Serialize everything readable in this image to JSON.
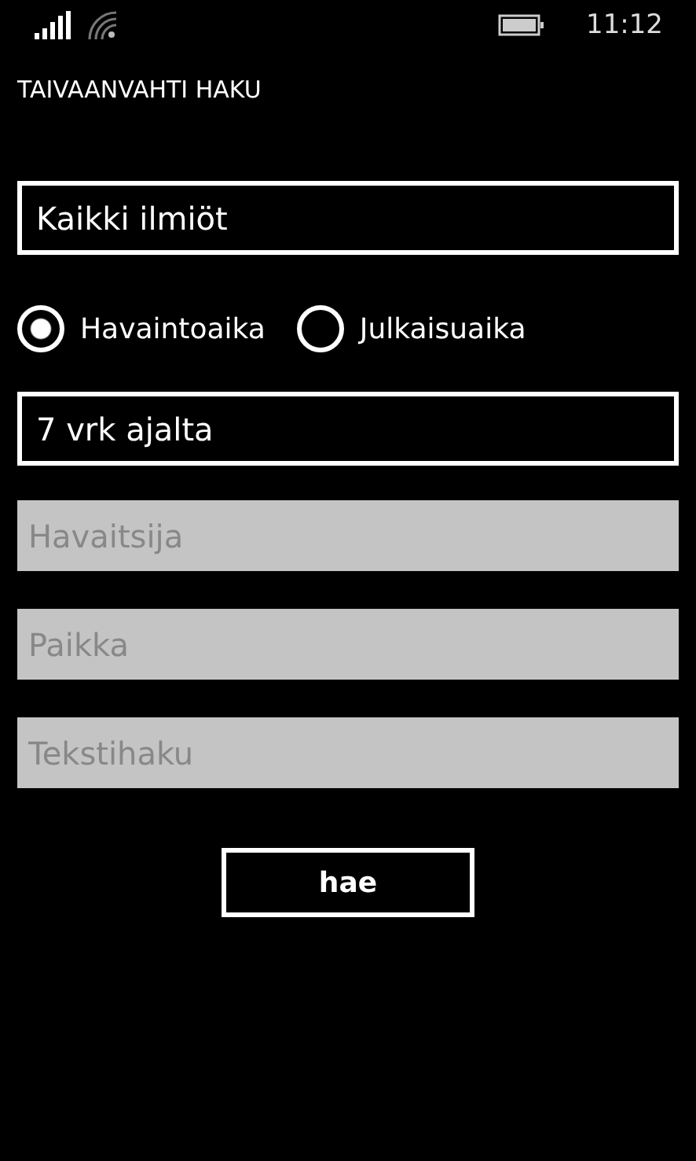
{
  "status_bar": {
    "time": "11:12"
  },
  "app_title": "TAIVAANVAHTI HAKU",
  "category_picker": {
    "value": "Kaikki ilmiöt"
  },
  "time_mode": [
    {
      "label": "Havaintoaika",
      "selected": true
    },
    {
      "label": "Julkaisuaika",
      "selected": false
    }
  ],
  "period_picker": {
    "value": "7 vrk ajalta"
  },
  "fields": [
    {
      "placeholder": "Havaitsija"
    },
    {
      "placeholder": "Paikka"
    },
    {
      "placeholder": "Tekstihaku"
    }
  ],
  "search_button": "hae"
}
